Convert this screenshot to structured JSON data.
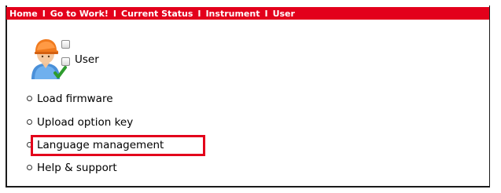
{
  "nav": {
    "items": [
      "Home",
      "Go to Work!",
      "Current Status",
      "Instrument",
      "User"
    ],
    "separator": "I"
  },
  "user": {
    "label": "User"
  },
  "menu": {
    "items": [
      {
        "label": "Load firmware"
      },
      {
        "label": "Upload option key"
      },
      {
        "label": "Language management",
        "highlighted": true
      },
      {
        "label": "Help & support"
      }
    ]
  },
  "colors": {
    "nav_bg": "#e3001b",
    "highlight": "#e3001b"
  }
}
